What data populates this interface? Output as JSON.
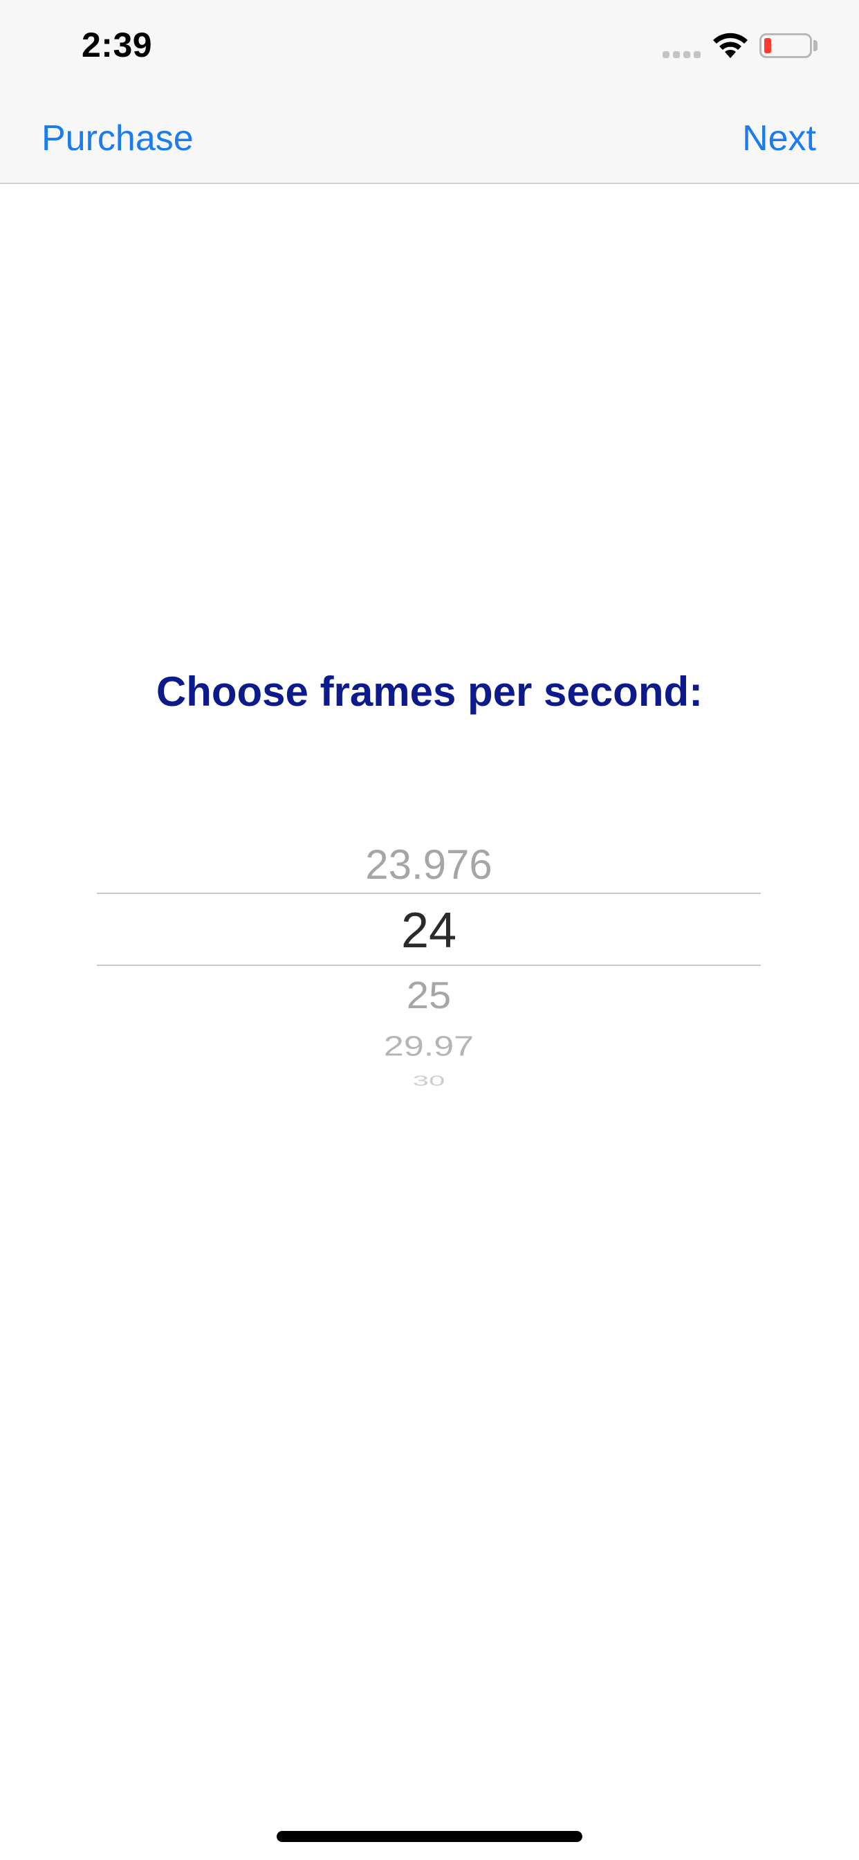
{
  "status_bar": {
    "time": "2:39",
    "signal_icon": "cellular-signal-icon",
    "wifi_icon": "wifi-icon",
    "battery_icon": "battery-icon",
    "battery_level_color": "#ff3b30"
  },
  "nav_bar": {
    "left_button": "Purchase",
    "right_button": "Next",
    "tint_color": "#1a7cf0"
  },
  "main": {
    "heading": "Choose frames per second:",
    "heading_color": "#0d1a8c"
  },
  "picker": {
    "options": [
      "23.976",
      "24",
      "25",
      "29.97",
      "30"
    ],
    "selected": "24"
  }
}
